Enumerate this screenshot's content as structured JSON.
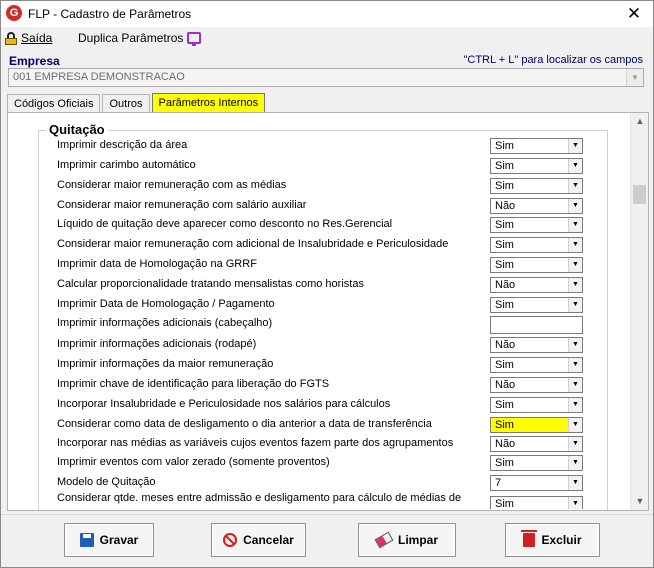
{
  "window": {
    "title": "FLP - Cadastro de Parâmetros",
    "app_icon_letter": "G",
    "close_label": "✕"
  },
  "toolbar": {
    "exit_label": "Saída",
    "duplicate_label": "Duplica Parâmetros"
  },
  "empresa": {
    "label": "Empresa",
    "hint": "\"CTRL + L\" para localizar os campos",
    "value": "001 EMPRESA DEMONSTRACAO"
  },
  "tabs": [
    {
      "label": "Códigos Oficiais",
      "active": false
    },
    {
      "label": "Outros",
      "active": false
    },
    {
      "label": "Parâmetros Internos",
      "active": true
    }
  ],
  "section": {
    "title": "Quitação",
    "rows": [
      {
        "label": "Imprimir descrição da área",
        "value": "Sim"
      },
      {
        "label": "Imprimir carimbo automático",
        "value": "Sim"
      },
      {
        "label": "Considerar maior remuneração com as médias",
        "value": "Sim"
      },
      {
        "label": "Considerar maior remuneração com salário auxiliar",
        "value": "Não"
      },
      {
        "label": "Líquido de quitação deve aparecer como desconto no Res.Gerencial",
        "value": "Sim"
      },
      {
        "label": "Considerar maior remuneração com adicional de Insalubridade e Periculosidade",
        "value": "Sim"
      },
      {
        "label": "Imprimir data de Homologação na GRRF",
        "value": "Sim"
      },
      {
        "label": "Calcular proporcionalidade tratando mensalistas como horistas",
        "value": "Não"
      },
      {
        "label": "Imprimir Data de  Homologação / Pagamento",
        "value": "Sim"
      },
      {
        "label": "Imprimir informações adicionais (cabeçalho)",
        "value": ""
      },
      {
        "label": "Imprimir informações adicionais (rodapé)",
        "value": "Não"
      },
      {
        "label": "Imprimir informações da maior remuneração",
        "value": "Sim"
      },
      {
        "label": "Imprimir chave de identificação para liberação do FGTS",
        "value": "Não"
      },
      {
        "label": "Incorporar Insalubridade e Periculosidade nos salários para cálculos",
        "value": "Sim"
      },
      {
        "label": "Considerar como data de desligamento o dia anterior a data de transferência",
        "value": "Sim",
        "highlight": true
      },
      {
        "label": "Incorporar nas médias as variáveis cujos eventos fazem parte dos agrupamentos",
        "value": "Não"
      },
      {
        "label": "Imprimir eventos com valor zerado (somente proventos)",
        "value": "Sim"
      },
      {
        "label": "Modelo de Quitação",
        "value": "7"
      },
      {
        "label": "Considerar qtde. meses entre admissão e desligamento para cálculo de médias de",
        "value": "Sim"
      }
    ]
  },
  "buttons": {
    "save": "Gravar",
    "cancel": "Cancelar",
    "clear": "Limpar",
    "delete": "Excluir"
  },
  "colors": {
    "highlight": "#ffff00",
    "label_blue": "#000066",
    "danger": "#d21f1f",
    "save_blue": "#1d5fb5"
  }
}
